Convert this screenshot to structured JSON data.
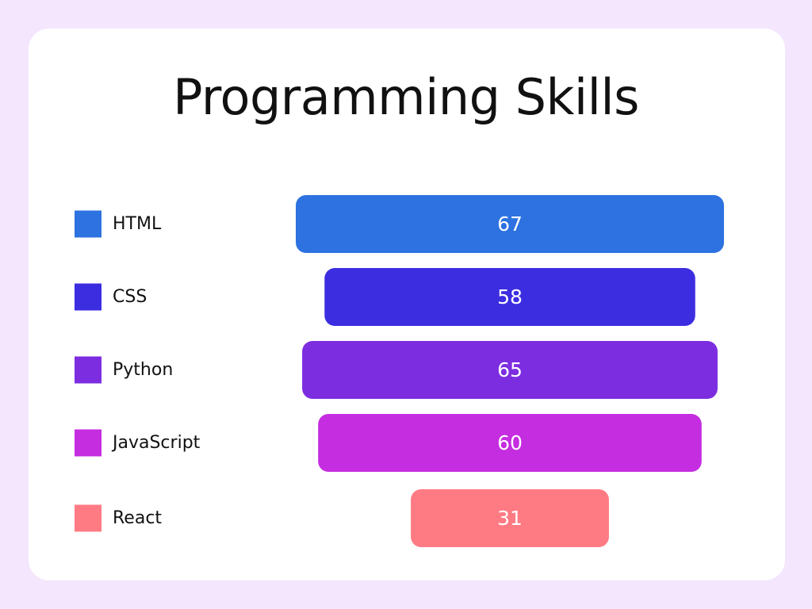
{
  "chart_data": {
    "type": "funnel",
    "title": "Programming Skills",
    "categories": [
      "HTML",
      "CSS",
      "Python",
      "JavaScript",
      "React"
    ],
    "values": [
      67,
      58,
      65,
      60,
      31
    ],
    "colors": [
      "#2d72e0",
      "#3c2de0",
      "#7d2de0",
      "#c52de0",
      "#ff7b84"
    ],
    "legend_position": "left",
    "data_labels": [
      "67",
      "58",
      "65",
      "60",
      "31"
    ]
  }
}
